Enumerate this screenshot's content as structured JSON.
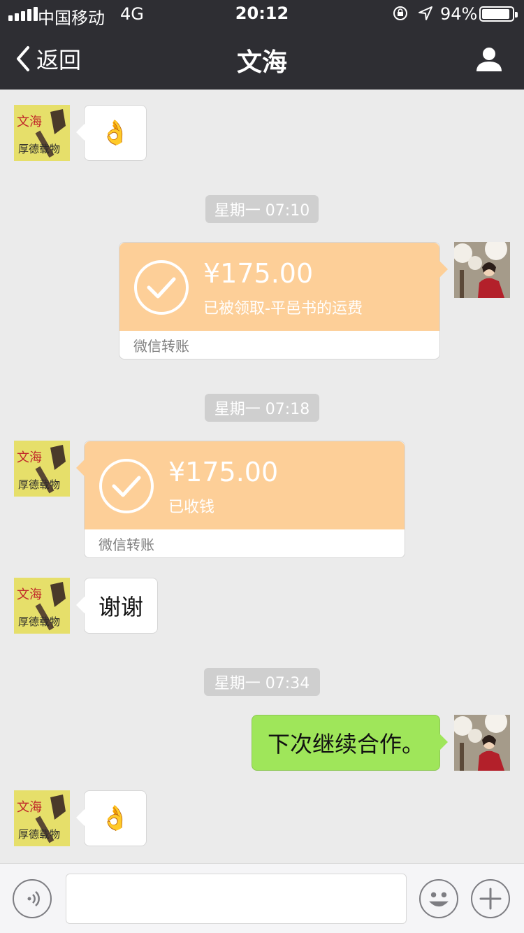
{
  "status_bar": {
    "carrier": "中国移动",
    "network": "4G",
    "time": "20:12",
    "battery_percent": "94%",
    "battery_level": 0.94,
    "icons": [
      "signal-icon",
      "orientation-lock-icon",
      "location-icon",
      "battery-icon"
    ]
  },
  "nav": {
    "back_label": "返回",
    "title": "文海",
    "icons": [
      "chevron-left-icon",
      "profile-icon"
    ]
  },
  "messages": {
    "m1": {
      "type": "emoji",
      "emoji": "👌",
      "side": "left"
    },
    "ts1": "星期一 07:10",
    "t1": {
      "amount": "¥175.00",
      "desc": "已被领取-平邑书的运费",
      "footer": "微信转账",
      "side": "right"
    },
    "ts2": "星期一 07:18",
    "t2": {
      "amount": "¥175.00",
      "desc": "已收钱",
      "footer": "微信转账",
      "side": "left"
    },
    "m2": {
      "text": "谢谢",
      "side": "left"
    },
    "ts3": "星期一 07:34",
    "m3": {
      "text": "下次继续合作。",
      "side": "right"
    },
    "m4": {
      "type": "emoji",
      "emoji": "👌",
      "side": "left"
    }
  },
  "input_bar": {
    "icons": [
      "voice-icon",
      "emoji-icon",
      "plus-icon"
    ],
    "text_value": ""
  },
  "colors": {
    "nav_bg": "#2e2e33",
    "chat_bg": "#ebebeb",
    "transfer_bg": "#fdcf98",
    "self_bubble": "#9fe65a"
  }
}
